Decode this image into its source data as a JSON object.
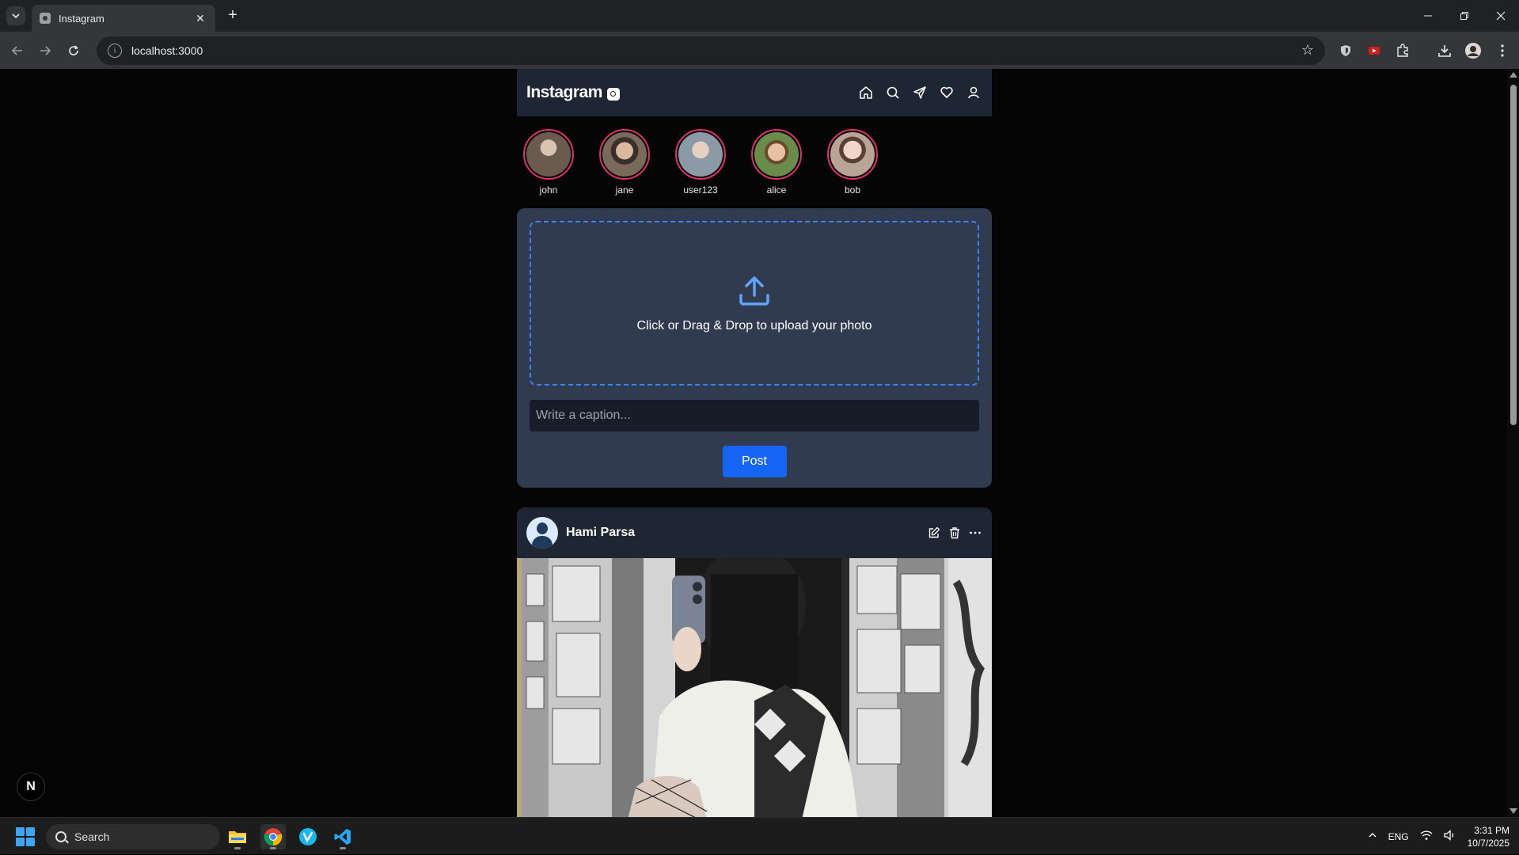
{
  "browser": {
    "tab_title": "Instagram",
    "url": "localhost:3000",
    "new_tab_symbol": "+",
    "close_symbol": "✕"
  },
  "app": {
    "logo_text": "Instagram",
    "stories": [
      {
        "name": "john",
        "color": "#6b5a4e"
      },
      {
        "name": "jane",
        "color": "#7a6a5c"
      },
      {
        "name": "user123",
        "color": "#8c9aa8"
      },
      {
        "name": "alice",
        "color": "#6a8c4a"
      },
      {
        "name": "bob",
        "color": "#b9a496"
      }
    ],
    "uploader": {
      "drop_text": "Click or Drag & Drop to upload your photo",
      "caption_placeholder": "Write a caption...",
      "post_label": "Post"
    },
    "post": {
      "username": "Hami Parsa"
    },
    "badge_letter": "N"
  },
  "taskbar": {
    "search_label": "Search",
    "language": "ENG",
    "time": "3:31 PM",
    "date": "10/7/2025"
  },
  "colors": {
    "accent": "#1665f5",
    "story_ring": "#e1306c",
    "dashed_border": "#3b82f6"
  }
}
